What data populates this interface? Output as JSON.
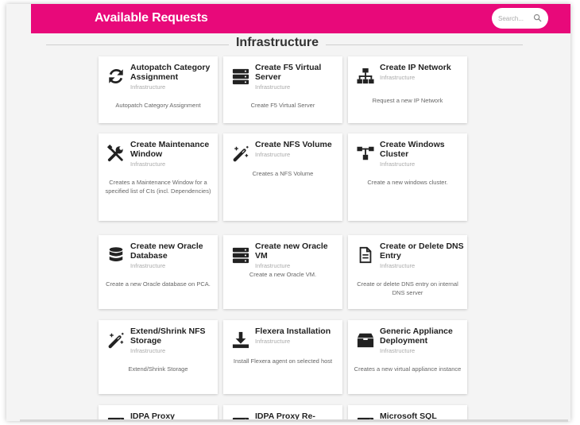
{
  "header": {
    "title": "Available Requests",
    "search_placeholder": "Search...",
    "accent_color": "#e8097a"
  },
  "section": {
    "title": "Infrastructure"
  },
  "cards": [
    {
      "title": "Autopatch Category Assignment",
      "category": "Infrastructure",
      "description": "Autopatch Category Assignment",
      "icon": "refresh-icon"
    },
    {
      "title": "Create F5 Virtual Server",
      "category": "Infrastructure",
      "description": "Create F5 Virtual Server",
      "icon": "server-icon"
    },
    {
      "title": "Create IP Network",
      "category": "Infrastructure",
      "description": "Request a new IP Network",
      "icon": "sitemap-icon"
    },
    {
      "title": "Create Maintenance Window",
      "category": "Infrastructure",
      "description": "Creates a Maintenance Window for a specified list of CIs (incl. Dependencies)",
      "icon": "tools-icon"
    },
    {
      "title": "Create NFS Volume",
      "category": "Infrastructure",
      "description": "Creates a NFS Volume",
      "icon": "magic-wand-icon"
    },
    {
      "title": "Create Windows Cluster",
      "category": "Infrastructure",
      "description": "Create a new windows cluster.",
      "icon": "network-tree-icon"
    },
    {
      "title": "Create new Oracle Database",
      "category": "Infrastructure",
      "description": "Create a new Oracle database on PCA.",
      "icon": "database-icon"
    },
    {
      "title": "Create new Oracle VM",
      "category": "Infrastructure",
      "description": "Create a new Oracle VM.",
      "icon": "server-icon"
    },
    {
      "title": "Create or Delete DNS Entry",
      "category": "Infrastructure",
      "description": "Create or delete DNS entry on internal DNS server",
      "icon": "document-icon"
    },
    {
      "title": "Extend/Shrink NFS Storage",
      "category": "Infrastructure",
      "description": "Extend/Shrink Storage",
      "icon": "magic-wand-icon"
    },
    {
      "title": "Flexera Installation",
      "category": "Infrastructure",
      "description": "Install Flexera agent on selected host",
      "icon": "download-icon"
    },
    {
      "title": "Generic Appliance Deployment",
      "category": "Infrastructure",
      "description": "Creates a new virtual appliance instance",
      "icon": "archive-box-icon"
    },
    {
      "title": "IDPA Proxy",
      "category": "",
      "description": "",
      "icon": "server-icon"
    },
    {
      "title": "IDPA Proxy Re-",
      "category": "",
      "description": "",
      "icon": "server-icon"
    },
    {
      "title": "Microsoft SQL Server",
      "category": "",
      "description": "",
      "icon": "server-icon"
    }
  ]
}
